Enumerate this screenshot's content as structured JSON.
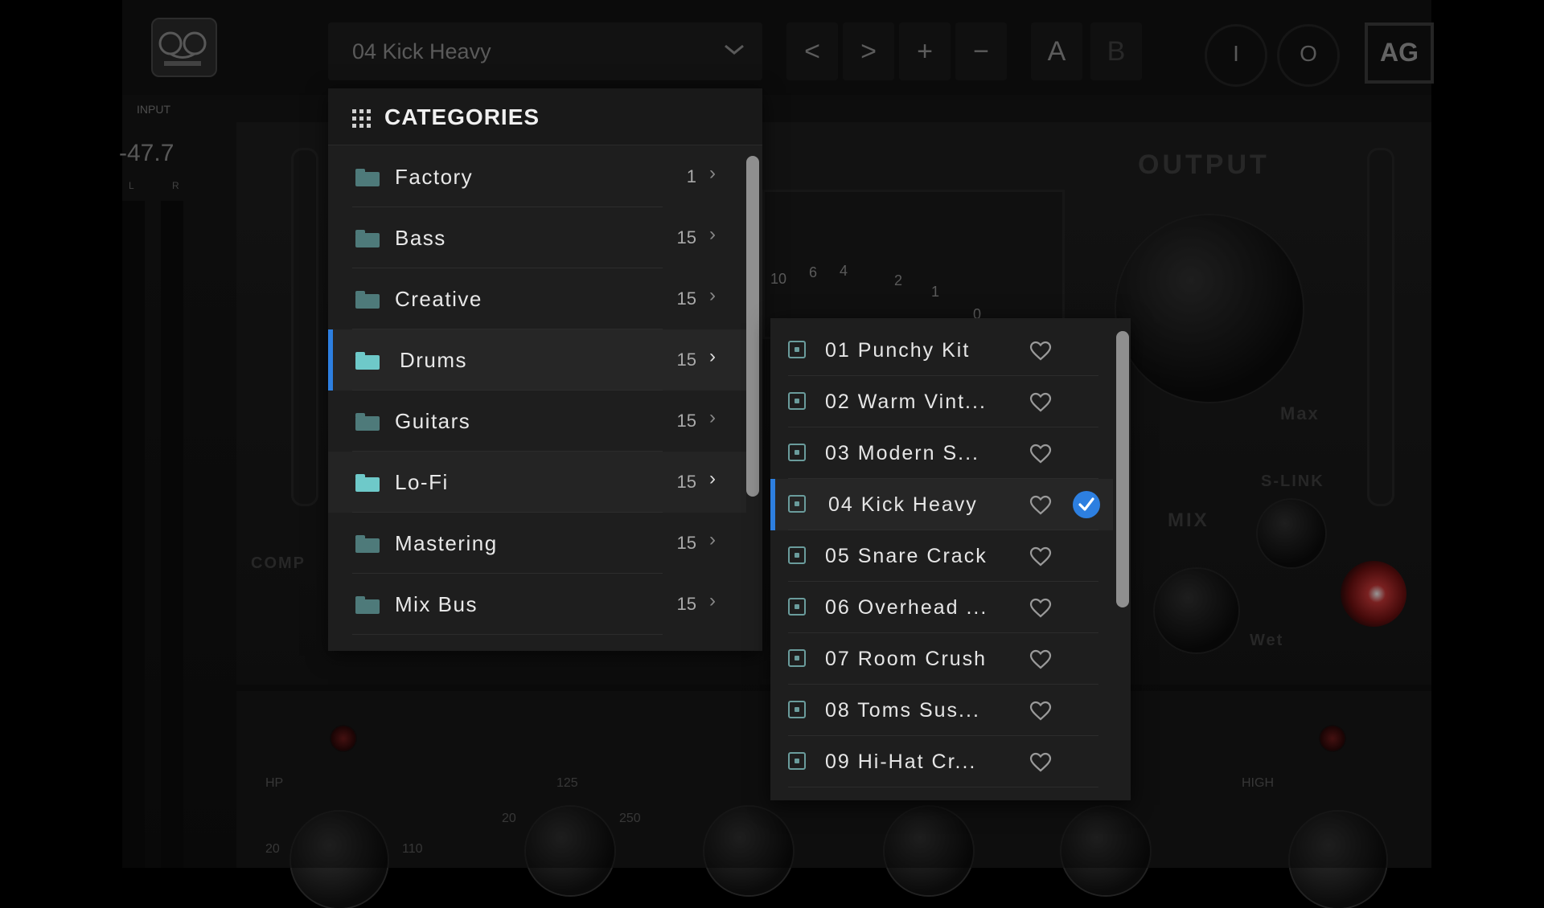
{
  "toolbar": {
    "preset_selected": "04 Kick Heavy",
    "chevron_icon": "chevron-down-icon",
    "prev_label": "<",
    "next_label": ">",
    "add_label": "+",
    "remove_label": "−",
    "a_label": "A",
    "b_label": "B",
    "in_label": "I",
    "out_label": "O",
    "ag_label": "AG"
  },
  "meter": {
    "title": "INPUT",
    "value": "-47.7",
    "left": "L",
    "right": "R"
  },
  "hardware": {
    "output": "OUTPUT",
    "max": "Max",
    "s_link": "S-LINK",
    "mix": "MIX",
    "wet": "Wet",
    "comp": "COMP",
    "hp": "HP",
    "high": "HIGH",
    "hp_20": "20",
    "hp_110": "110",
    "eq_125": "125",
    "eq_20": "20",
    "eq_250": "250",
    "vu_scale": [
      "10",
      "6",
      "4",
      "2",
      "1",
      "0"
    ]
  },
  "categories": {
    "title": "CATEGORIES",
    "items": [
      {
        "label": "Factory",
        "count": "1"
      },
      {
        "label": "Bass",
        "count": "15"
      },
      {
        "label": "Creative",
        "count": "15"
      },
      {
        "label": "Drums",
        "count": "15"
      },
      {
        "label": "Guitars",
        "count": "15"
      },
      {
        "label": "Lo-Fi",
        "count": "15"
      },
      {
        "label": "Mastering",
        "count": "15"
      },
      {
        "label": "Mix Bus",
        "count": "15"
      }
    ],
    "selected": "Drums",
    "hovered": "Lo-Fi"
  },
  "presets": {
    "items": [
      {
        "label": "01 Punchy Kit"
      },
      {
        "label": "02 Warm Vint..."
      },
      {
        "label": "03 Modern S..."
      },
      {
        "label": "04 Kick Heavy"
      },
      {
        "label": "05 Snare Crack"
      },
      {
        "label": "06 Overhead ..."
      },
      {
        "label": "07 Room Crush"
      },
      {
        "label": "08 Toms Sus..."
      },
      {
        "label": "09 Hi-Hat Cr..."
      }
    ],
    "selected": "04 Kick Heavy"
  },
  "colors": {
    "accent": "#2d7fe0",
    "folder": "#4e7a7a",
    "folder_active": "#6ec9c9",
    "panel": "#1e1e1e"
  }
}
